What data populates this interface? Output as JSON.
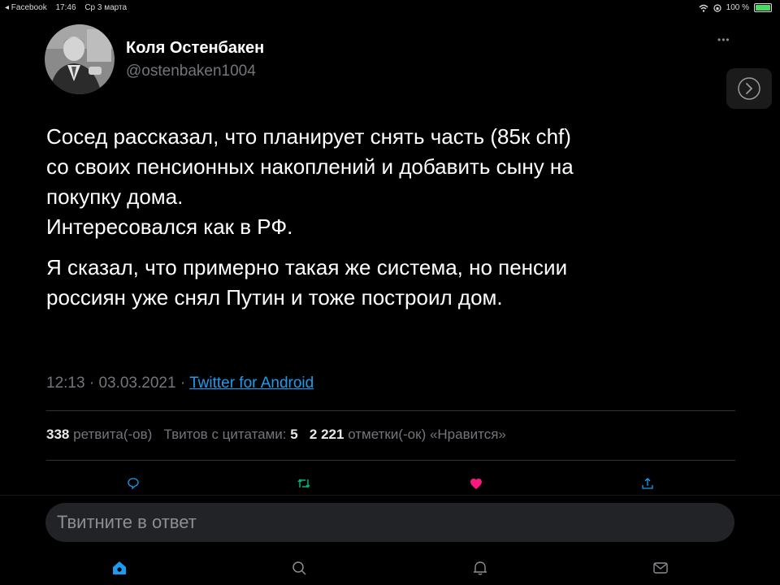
{
  "status_bar": {
    "back_app": "◂ Facebook",
    "time": "17:46",
    "date": "Ср 3 марта",
    "battery": "100 %"
  },
  "tweet": {
    "author_name": "Коля Остенбакен",
    "author_handle": "@ostenbaken1004",
    "paragraph1": [
      "Сосед рассказал, что планирует снять часть (85к chf)",
      "со своих пенсионных накоплений и добавить сыну на",
      "покупку дома.",
      "Интересовался как в РФ."
    ],
    "paragraph2": [
      "Я сказал, что примерно такая же система, но пенсии",
      "россиян уже снял Путин и тоже построил дом."
    ],
    "time": "12:13",
    "date": "03.03.2021",
    "source": "Twitter for Android"
  },
  "stats": {
    "retweets_count": "338",
    "retweets_label": "ретвита(-ов)",
    "quotes_label": "Твитов с цитатами:",
    "quotes_count": "5",
    "likes_count": "2 221",
    "likes_label": "отметки(-ок) «Нравится»"
  },
  "actions": [
    "reply-icon",
    "retweet-icon",
    "heart-icon",
    "share-icon"
  ],
  "reply_placeholder": "Твитните в ответ",
  "bottom_nav": [
    "home-icon",
    "search-icon",
    "notifications-icon",
    "messages-icon"
  ],
  "colors": {
    "accent": "#1d9bf0",
    "retweet": "#00ba7c",
    "like": "#f91880",
    "background": "#000000"
  }
}
